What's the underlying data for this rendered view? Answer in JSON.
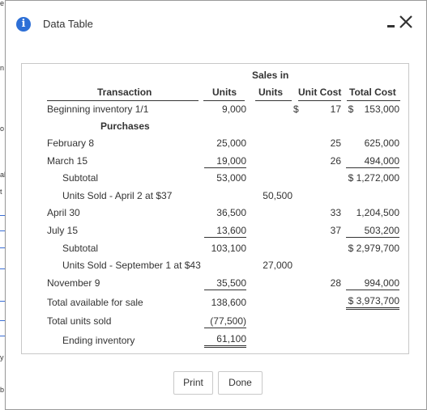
{
  "dialog": {
    "title": "Data Table",
    "buttons": {
      "print": "Print",
      "done": "Done"
    }
  },
  "table": {
    "headers": {
      "sales_in_line1": "Sales in",
      "transaction": "Transaction",
      "units": "Units",
      "sales_units": "Units",
      "unit_cost": "Unit Cost",
      "total_cost": "Total Cost"
    },
    "rows": [
      {
        "label": "Beginning inventory 1/1",
        "units": "9,000",
        "sales": "",
        "unit_cost_prefix": "$",
        "unit_cost": "17",
        "total": "$    153,000"
      },
      {
        "label": "Purchases"
      },
      {
        "label": "February 8",
        "units": "25,000",
        "unit_cost": "25",
        "total": "625,000"
      },
      {
        "label": "March 15",
        "units": "19,000",
        "unit_cost": "26",
        "total": "494,000"
      },
      {
        "label": "Subtotal",
        "units": "53,000",
        "total": "$ 1,272,000"
      },
      {
        "label": "Units Sold - April 2 at $37",
        "sales": "50,500"
      },
      {
        "label": "April 30",
        "units": "36,500",
        "unit_cost": "33",
        "total": "1,204,500"
      },
      {
        "label": "July 15",
        "units": "13,600",
        "unit_cost": "37",
        "total": "503,200"
      },
      {
        "label": "Subtotal",
        "units": "103,100",
        "total": "$ 2,979,700"
      },
      {
        "label": "Units Sold - September 1 at $43",
        "sales": "27,000"
      },
      {
        "label": "November 9",
        "units": "35,500",
        "unit_cost": "28",
        "total": "994,000"
      },
      {
        "label": "Total available for sale",
        "units": "138,600",
        "total": "$ 3,973,700"
      },
      {
        "label": "Total units sold",
        "units": "(77,500)"
      },
      {
        "label": "Ending inventory",
        "units": "61,100"
      }
    ]
  }
}
